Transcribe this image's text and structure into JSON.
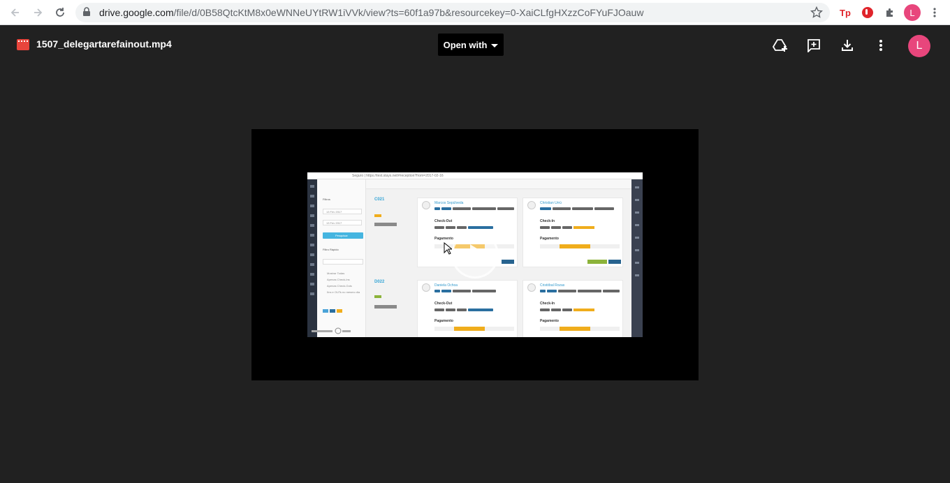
{
  "browser": {
    "url_host": "drive.google.com",
    "url_path": "/file/d/0B58QtcKtM8x0eWNNeUYtRW1iVVk/view?ts=60f1a97b&resourcekey=0-XaiCLfgHXzzCoFYuFJOauw",
    "profile_initial": "L",
    "extension_tp_label": "Tp"
  },
  "viewer": {
    "file_name": "1507_delegartarefainout.mp4",
    "open_with_label": "Open with",
    "account_initial": "L",
    "accent_color": "#e8467c",
    "file_icon_color": "#e8453c"
  },
  "video_frame": {
    "url": "Seguro | https://test.stays.net/#reception?from=2017-02-16",
    "left_panel": {
      "filters_title": "Filtros",
      "date_from": "13 Fev 2017",
      "date_to": "13 Fev 2017",
      "search_button": "Pesquisar",
      "quick_filter_title": "Filtro Rápido",
      "options": [
        "Mostrar Todas",
        "Apenas Check-Ins",
        "Apenas Check-Outs",
        "IIns e OUTs no mesmo dia"
      ]
    },
    "units": [
      {
        "code": "C021"
      },
      {
        "code": "D022"
      }
    ],
    "cards": [
      {
        "name": "Marcos Sepúlveda",
        "section": "Check-Out",
        "payment": "Pagamento"
      },
      {
        "name": "Christian Urrú",
        "section": "Check-In",
        "payment": "Pagamento"
      },
      {
        "name": "Daniela Ochoa",
        "section": "Check-Out",
        "payment": "Pagamento"
      },
      {
        "name": "Cristóbal Rozas",
        "section": "Check-In",
        "payment": "Pagamento"
      }
    ]
  }
}
